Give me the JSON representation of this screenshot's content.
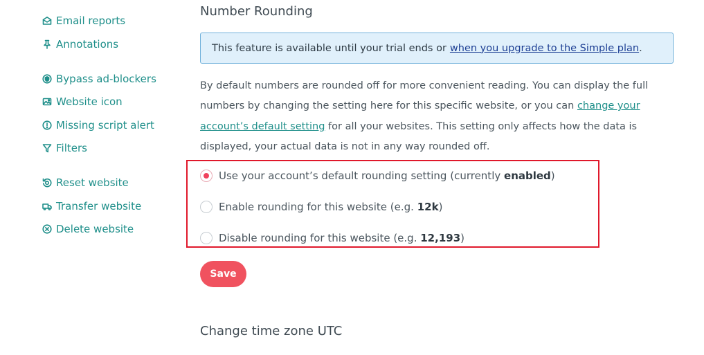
{
  "sidebar": {
    "items": [
      {
        "label": "Email reports",
        "icon": "envelope-icon"
      },
      {
        "label": "Annotations",
        "icon": "pin-icon"
      },
      {
        "label": "Bypass ad-blockers",
        "icon": "shield-icon"
      },
      {
        "label": "Website icon",
        "icon": "image-icon"
      },
      {
        "label": "Missing script alert",
        "icon": "alert-circle-icon"
      },
      {
        "label": "Filters",
        "icon": "filter-icon"
      },
      {
        "label": "Reset website",
        "icon": "reset-icon"
      },
      {
        "label": "Transfer website",
        "icon": "truck-icon"
      },
      {
        "label": "Delete website",
        "icon": "delete-circle-icon"
      }
    ]
  },
  "number_rounding": {
    "title": "Number Rounding",
    "notice_text": "This feature is available until your trial ends or",
    "notice_link": "when you upgrade to the Simple plan",
    "notice_end": ".",
    "description_1": "By default numbers are rounded off for more convenient reading. You can display the full numbers by changing the setting here for this specific website, or you can",
    "description_link": "change your account’s default setting",
    "description_2": "for all your websites. This setting only affects how the data is displayed, your actual data is not in any way rounded off.",
    "options": [
      {
        "text": "Use your account’s default rounding setting (currently ",
        "bold": "enabled",
        "end": ")",
        "checked": true
      },
      {
        "text": "Enable rounding for this website (e.g. ",
        "bold": "12k",
        "end": ")",
        "checked": false
      },
      {
        "text": "Disable rounding for this website (e.g. ",
        "bold": "12,193",
        "end": ")",
        "checked": false
      }
    ],
    "save_label": "Save"
  },
  "time_zone": {
    "title": "Change time zone UTC"
  },
  "colors": {
    "accent": "#1f8f8a",
    "save_button": "#f0525f",
    "highlight_border": "#e0182b",
    "notice_bg": "#e0f0fb"
  }
}
